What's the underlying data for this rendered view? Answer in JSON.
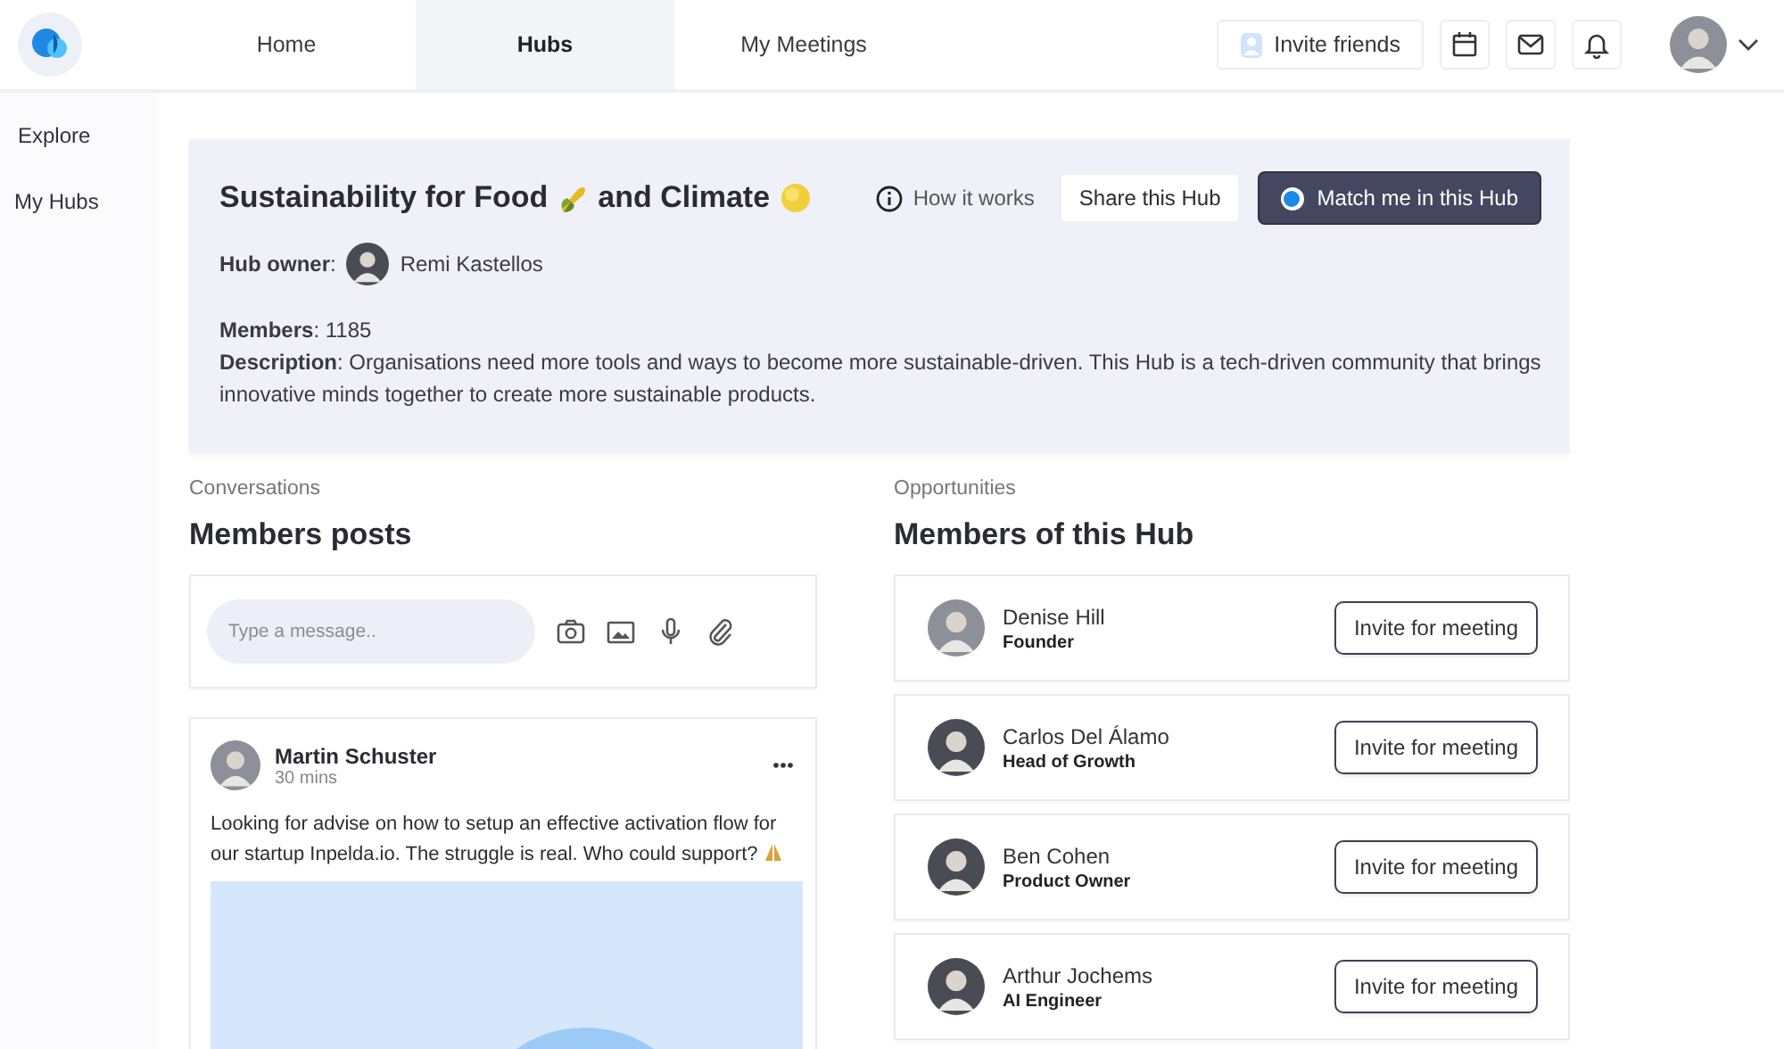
{
  "nav": {
    "tabs": [
      {
        "label": "Home",
        "selected": false
      },
      {
        "label": "Hubs",
        "selected": true
      },
      {
        "label": "My Meetings",
        "selected": false
      }
    ],
    "invite_button": "Invite friends"
  },
  "sidebar": {
    "items": [
      {
        "label": "Explore",
        "selected": false
      },
      {
        "label": "My Hubs",
        "selected": false
      }
    ]
  },
  "hub": {
    "title_parts": [
      "Sustainability for Food",
      "and Climate"
    ],
    "how_it_works": "How it works",
    "share_button": "Share this Hub",
    "match_button": "Match me in this Hub",
    "owner_label": "**Hub owner**:",
    "owner_name": "Remi Kastellos",
    "members": "**Members**: 1185",
    "description": "**Description**: Organisations need more tools and ways to become more sustainable-driven. This Hub is a tech-driven community that brings innovative minds together to create more sustainable products."
  },
  "conversations": {
    "section_label": "Conversations",
    "heading": "Members posts",
    "composer": {
      "placeholder": "Type a message.."
    },
    "posts": [
      {
        "author": "Martin Schuster",
        "time": "30 mins",
        "text": "Looking for advise on how to setup an effective activation flow for our startup Inpelda.io. The struggle is real. Who could support?"
      }
    ]
  },
  "opportunities": {
    "section_label": "Opportunities",
    "heading": "Members of this Hub",
    "members": [
      {
        "name": "Denise Hill",
        "role": "Founder",
        "button": "Invite for meeting"
      },
      {
        "name": "Carlos Del Álamo",
        "role": "Head of Growth",
        "button": "Invite for meeting"
      },
      {
        "name": "Ben Cohen",
        "role": "Product Owner",
        "button": "Invite for meeting"
      },
      {
        "name": "Arthur Jochems",
        "role": "AI Engineer",
        "button": "Invite for meeting"
      }
    ]
  }
}
